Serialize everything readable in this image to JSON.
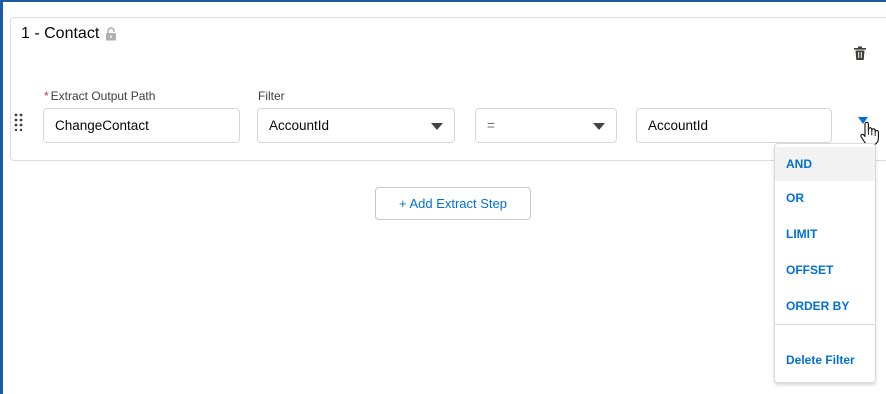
{
  "step": {
    "title": "1 - Contact",
    "output_path_label": "Extract Output Path",
    "required_mark": "*",
    "output_path_value": "ChangeContact",
    "filter_label": "Filter",
    "filter_field_value": "AccountId",
    "filter_operator_value": "=",
    "filter_value": "AccountId"
  },
  "add_step_label": "+ Add Extract Step",
  "filter_menu": {
    "items": [
      "AND",
      "OR",
      "LIMIT",
      "OFFSET",
      "ORDER BY"
    ],
    "delete_label": "Delete Filter"
  },
  "colors": {
    "accent": "#0070d2",
    "frame": "#1f5a9e",
    "required": "#c23934"
  },
  "icons": [
    "lock-icon",
    "trash-icon",
    "drag-handle-icon",
    "chevron-down-icon",
    "hand-cursor-icon"
  ]
}
